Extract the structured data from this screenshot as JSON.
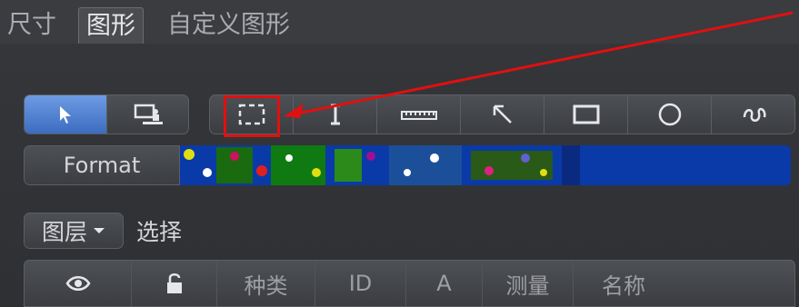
{
  "tabs": [
    {
      "label": "尺寸",
      "active": false
    },
    {
      "label": "图形",
      "active": true
    },
    {
      "label": "自定义图形",
      "active": false
    }
  ],
  "mode_buttons": [
    {
      "icon": "arrow-pointer-icon",
      "selected": true
    },
    {
      "icon": "screen-presenter-icon",
      "selected": false
    }
  ],
  "shape_tools": [
    {
      "icon": "dashed-rectangle-icon"
    },
    {
      "icon": "text-cursor-icon"
    },
    {
      "icon": "ruler-icon"
    },
    {
      "icon": "diagonal-arrow-icon"
    },
    {
      "icon": "rectangle-icon"
    },
    {
      "icon": "circle-icon"
    },
    {
      "icon": "freehand-curve-icon"
    }
  ],
  "format": {
    "button_label": "Format"
  },
  "layer": {
    "dropdown_label": "图层",
    "select_label": "选择"
  },
  "table_headers": [
    "种类",
    "ID",
    "A",
    "测量",
    "名称"
  ],
  "colors": {
    "accent": "#4f7fd3",
    "highlight": "#e01010"
  }
}
